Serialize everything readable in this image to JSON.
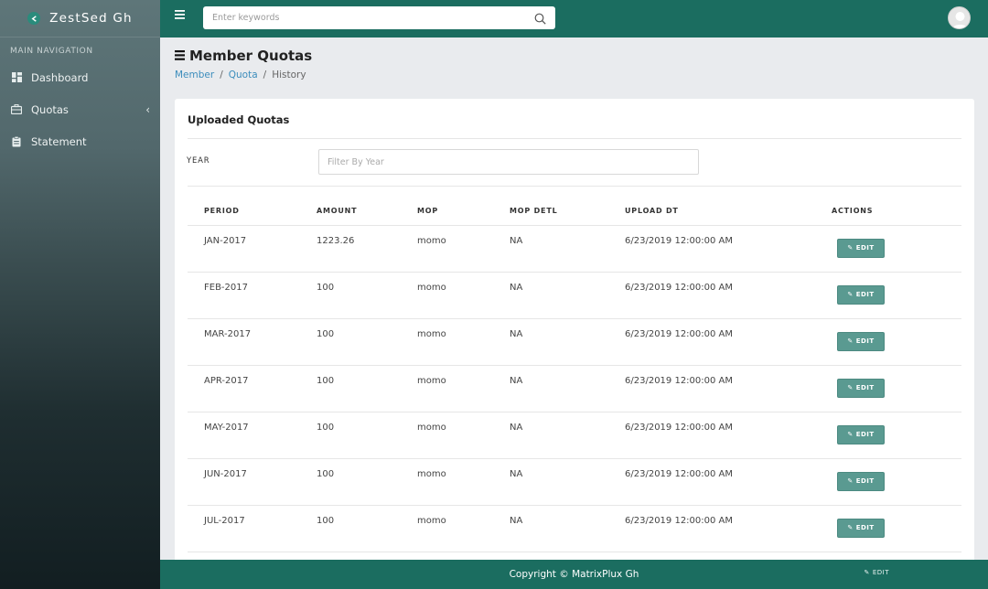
{
  "brand": {
    "name": "ZestSed Gh",
    "logo_icon": "leaf-icon"
  },
  "sidebar": {
    "header": "MAIN NAVIGATION",
    "items": [
      {
        "label": "Dashboard",
        "icon": "dashboard-icon"
      },
      {
        "label": "Quotas",
        "icon": "briefcase-icon",
        "has_submenu": true
      },
      {
        "label": "Statement",
        "icon": "clipboard-icon"
      }
    ]
  },
  "topbar": {
    "search_placeholder": "Enter keywords",
    "menu_icon": "hamburger-icon",
    "search_icon": "search-icon",
    "avatar_icon": "user-avatar-icon"
  },
  "page": {
    "title": "Member Quotas",
    "breadcrumb": [
      "Member",
      "Quota",
      "History"
    ]
  },
  "card": {
    "title": "Uploaded Quotas",
    "year_label": "YEAR",
    "year_placeholder": "Filter By Year",
    "columns": [
      "PERIOD",
      "AMOUNT",
      "MOP",
      "MOP DETL",
      "UPLOAD DT",
      "ACTIONS"
    ],
    "edit_label": "EDIT",
    "rows": [
      {
        "period": "JAN-2017",
        "amount": "1223.26",
        "mop": "momo",
        "mop_detl": "NA",
        "upload_dt": "6/23/2019 12:00:00 AM"
      },
      {
        "period": "FEB-2017",
        "amount": "100",
        "mop": "momo",
        "mop_detl": "NA",
        "upload_dt": "6/23/2019 12:00:00 AM"
      },
      {
        "period": "MAR-2017",
        "amount": "100",
        "mop": "momo",
        "mop_detl": "NA",
        "upload_dt": "6/23/2019 12:00:00 AM"
      },
      {
        "period": "APR-2017",
        "amount": "100",
        "mop": "momo",
        "mop_detl": "NA",
        "upload_dt": "6/23/2019 12:00:00 AM"
      },
      {
        "period": "MAY-2017",
        "amount": "100",
        "mop": "momo",
        "mop_detl": "NA",
        "upload_dt": "6/23/2019 12:00:00 AM"
      },
      {
        "period": "JUN-2017",
        "amount": "100",
        "mop": "momo",
        "mop_detl": "NA",
        "upload_dt": "6/23/2019 12:00:00 AM"
      },
      {
        "period": "JUL-2017",
        "amount": "100",
        "mop": "momo",
        "mop_detl": "NA",
        "upload_dt": "6/23/2019 12:00:00 AM"
      }
    ]
  },
  "footer": {
    "copyright": "Copyright © MatrixPlux Gh",
    "edit_label": "EDIT"
  },
  "colors": {
    "primary": "#1b6d60",
    "button": "#5a9a91",
    "link": "#3c8dbc"
  }
}
